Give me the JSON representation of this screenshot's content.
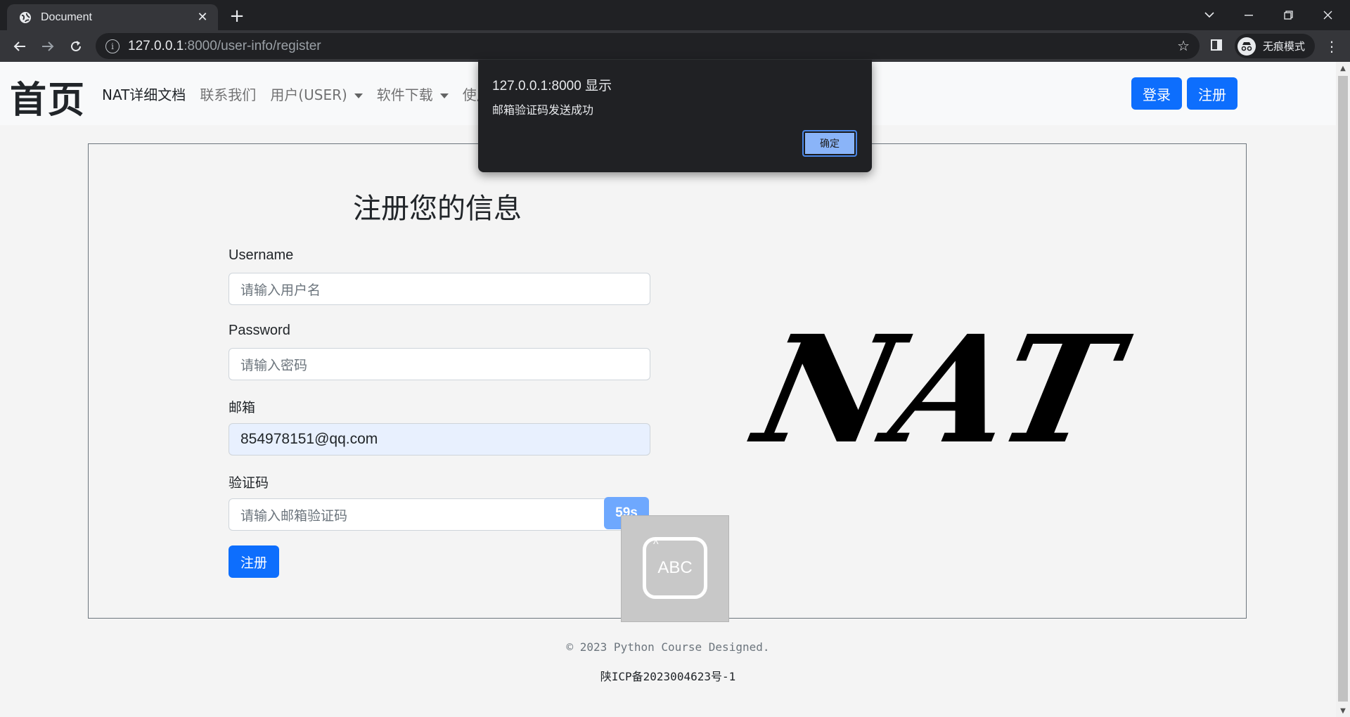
{
  "browser": {
    "tab_title": "Document",
    "tab_close": "✕",
    "new_tab": "+",
    "url_host": "127.0.0.1",
    "url_path": ":8000/user-info/register",
    "profile_label": "无痕模式",
    "win_min": "─",
    "win_restore": "❐",
    "win_close": "✕",
    "win_dropdown": "⌵"
  },
  "site": {
    "brand": "首页",
    "nav": [
      {
        "label": "NAT详细文档",
        "active": true
      },
      {
        "label": "联系我们"
      },
      {
        "label": "用户(USER)",
        "dropdown": true
      },
      {
        "label": "软件下载",
        "dropdown": true
      },
      {
        "label": "使用"
      }
    ],
    "login_label": "登录",
    "register_label": "注册"
  },
  "form": {
    "title": "注册您的信息",
    "username_label": "Username",
    "username_placeholder": "请输入用户名",
    "password_label": "Password",
    "password_placeholder": "请输入密码",
    "email_label": "邮箱",
    "email_value": "854978151@qq.com",
    "code_label": "验证码",
    "code_placeholder": "请输入邮箱验证码",
    "countdown_label": "59s",
    "submit_label": "注册"
  },
  "logo_text": "NAT",
  "ime": {
    "label": "ABC"
  },
  "footer": {
    "copyright": "© 2023 Python Course Designed.",
    "icp": "陕ICP备2023004623号-1"
  },
  "dialog": {
    "title_host": "127.0.0.1:8000",
    "title_suffix": "显示",
    "message": "邮箱验证码发送成功",
    "ok_label": "确定"
  }
}
